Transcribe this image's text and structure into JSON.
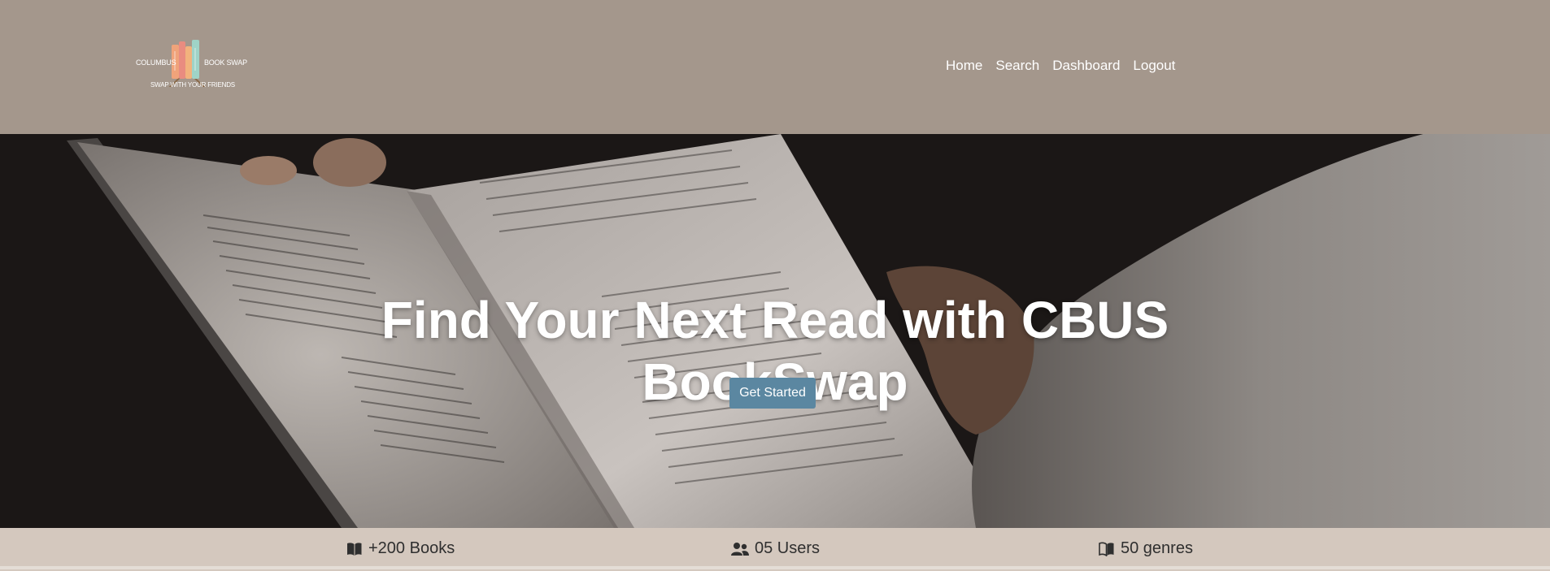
{
  "logo": {
    "left_text": "COLUMBUS",
    "right_text": "BOOK SWAP",
    "tagline": "SWAP WITH YOUR FRIENDS"
  },
  "nav": {
    "home": "Home",
    "search": "Search",
    "dashboard": "Dashboard",
    "logout": "Logout"
  },
  "hero": {
    "title_line1": "Find Your Next Read with CBUS",
    "title_line2": "BookSwap",
    "cta": "Get Started"
  },
  "stats": {
    "books": "+200 Books",
    "users": "05 Users",
    "genres": "50 genres"
  },
  "colors": {
    "header": "#a4978c",
    "stats_bar": "#d4c8be",
    "cta": "#5b87a1"
  },
  "icons": [
    "book-icon",
    "users-icon",
    "book-open-icon"
  ]
}
